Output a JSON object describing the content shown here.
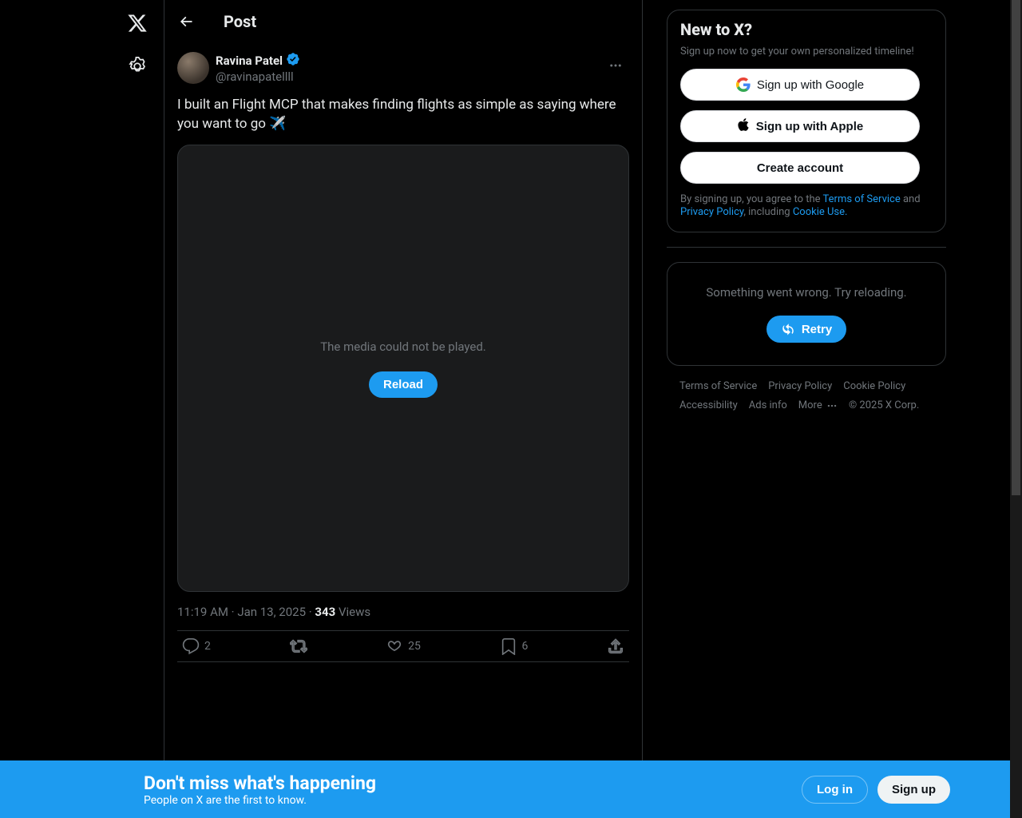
{
  "header": {
    "title": "Post"
  },
  "post": {
    "author": {
      "display_name": "Ravina Patel",
      "handle": "@ravinapatellll"
    },
    "text": "I built an Flight MCP that makes finding flights as simple as saying where you want to go ✈️",
    "media_error": "The media could not be played.",
    "reload_label": "Reload",
    "timestamp": "11:19 AM · Jan 13, 2025",
    "views_count": "343",
    "views_label": "Views",
    "actions": {
      "replies": "2",
      "likes": "25",
      "bookmarks": "6"
    }
  },
  "signup": {
    "title": "New to X?",
    "subtitle": "Sign up now to get your own personalized timeline!",
    "google_label": "Sign up with Google",
    "apple_label": "Sign up with Apple",
    "create_label": "Create account",
    "tos_prefix": "By signing up, you agree to the ",
    "tos": "Terms of Service",
    "and": " and ",
    "privacy": "Privacy Policy",
    "including": ", including ",
    "cookie": "Cookie Use."
  },
  "error_panel": {
    "message": "Something went wrong. Try reloading.",
    "retry_label": "Retry"
  },
  "footer": {
    "tos": "Terms of Service",
    "privacy": "Privacy Policy",
    "cookie": "Cookie Policy",
    "accessibility": "Accessibility",
    "ads": "Ads info",
    "more": "More",
    "copyright": "© 2025 X Corp."
  },
  "banner": {
    "title": "Don't miss what's happening",
    "subtitle": "People on X are the first to know.",
    "login": "Log in",
    "signup": "Sign up"
  }
}
